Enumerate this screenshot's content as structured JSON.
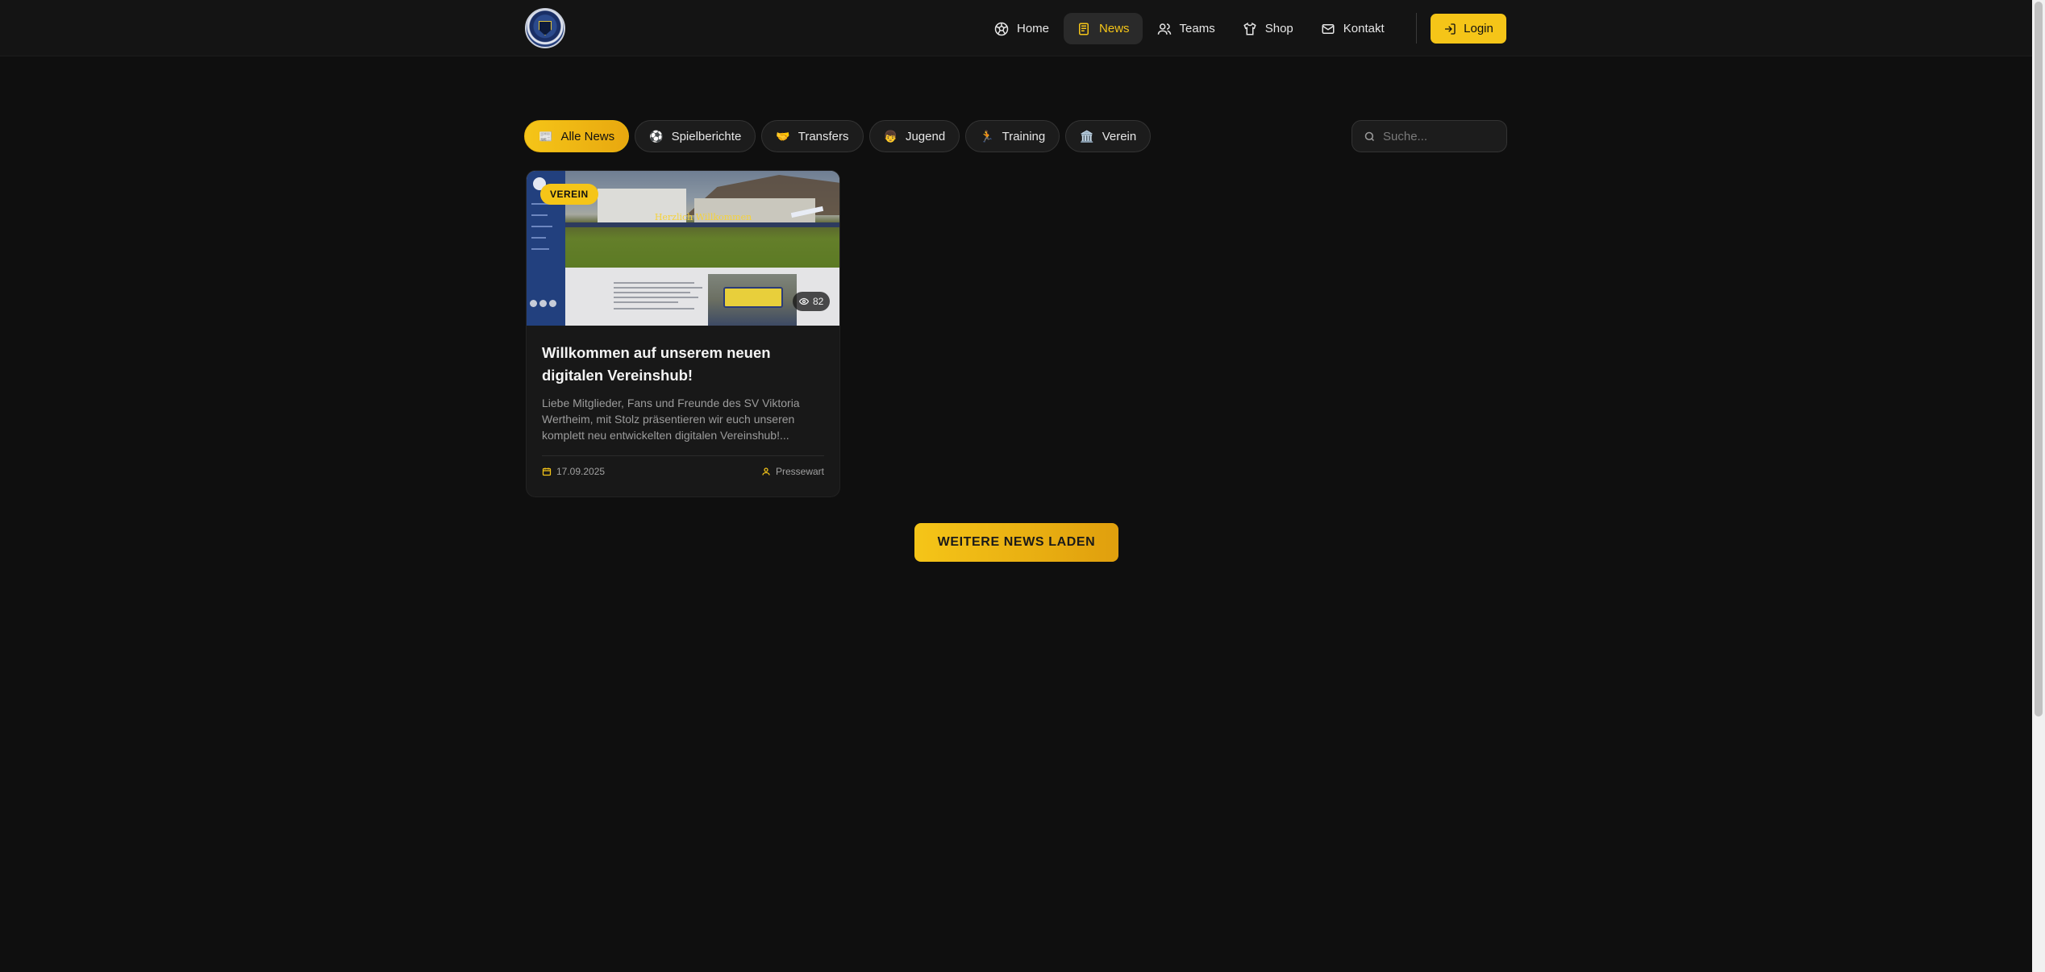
{
  "header": {
    "nav": [
      {
        "label": "Home",
        "icon": "soccer-ball-icon",
        "active": false
      },
      {
        "label": "News",
        "icon": "newspaper-icon",
        "active": true
      },
      {
        "label": "Teams",
        "icon": "users-icon",
        "active": false
      },
      {
        "label": "Shop",
        "icon": "shirt-icon",
        "active": false
      },
      {
        "label": "Kontakt",
        "icon": "mail-icon",
        "active": false
      }
    ],
    "login_label": "Login"
  },
  "filters": [
    {
      "emoji": "📰",
      "label": "Alle News",
      "active": true
    },
    {
      "emoji": "⚽",
      "label": "Spielberichte",
      "active": false
    },
    {
      "emoji": "🤝",
      "label": "Transfers",
      "active": false
    },
    {
      "emoji": "👦",
      "label": "Jugend",
      "active": false
    },
    {
      "emoji": "🏃",
      "label": "Training",
      "active": false
    },
    {
      "emoji": "🏛️",
      "label": "Verein",
      "active": false
    }
  ],
  "search": {
    "placeholder": "Suche..."
  },
  "articles": [
    {
      "category": "VEREIN",
      "views": "82",
      "image_welcome_text": "Herzlich Willkommen",
      "title": "Willkommen auf unserem neuen digitalen Vereinshub!",
      "excerpt": "Liebe Mitglieder, Fans und Freunde des SV Viktoria Wertheim, mit Stolz präsentieren wir euch unseren komplett neu entwickelten digitalen Vereinshub!...",
      "date": "17.09.2025",
      "author": "Pressewart"
    }
  ],
  "load_more_label": "WEITERE NEWS LADEN",
  "colors": {
    "accent": "#f5c518",
    "background": "#0f0f0f",
    "card": "#181818"
  }
}
